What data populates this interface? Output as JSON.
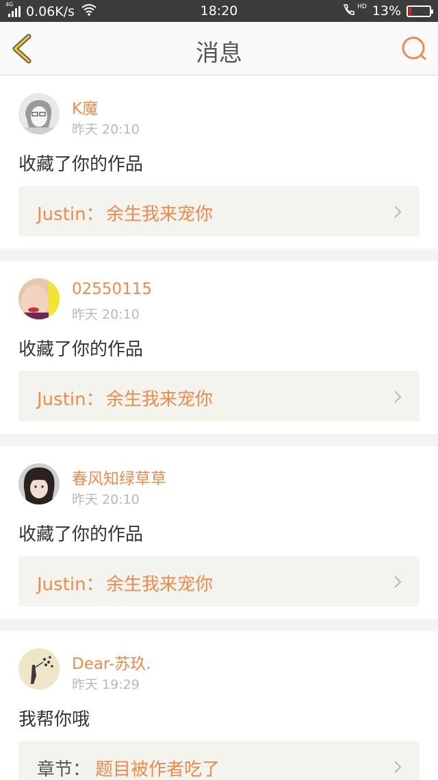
{
  "status_bar": {
    "network": "4G",
    "speed": "0.06K/s",
    "time": "18:20",
    "hd": "HD",
    "battery_text": "13%",
    "battery_level": 0.13
  },
  "header": {
    "title": "消息",
    "back_icon": "chevron-left-icon",
    "search_icon": "search-icon"
  },
  "colors": {
    "accent": "#f08a4b",
    "back_icon": "#f2c81e"
  },
  "messages": [
    {
      "username": "K魔",
      "time": "昨天 20:10",
      "action": "收藏了你的作品",
      "link_prefix": "Justin：",
      "link_title": "余生我来宠你"
    },
    {
      "username": "02550115",
      "time": "昨天 20:10",
      "action": "收藏了你的作品",
      "link_prefix": "Justin：",
      "link_title": "余生我来宠你"
    },
    {
      "username": "春风知绿草草",
      "time": "昨天 20:10",
      "action": "收藏了你的作品",
      "link_prefix": "Justin：",
      "link_title": "余生我来宠你"
    },
    {
      "username": "Dear-苏玖.",
      "time": "昨天 19:29",
      "action": "我帮你哦",
      "link_prefix": "章节：",
      "link_title": "题目被作者吃了"
    }
  ]
}
